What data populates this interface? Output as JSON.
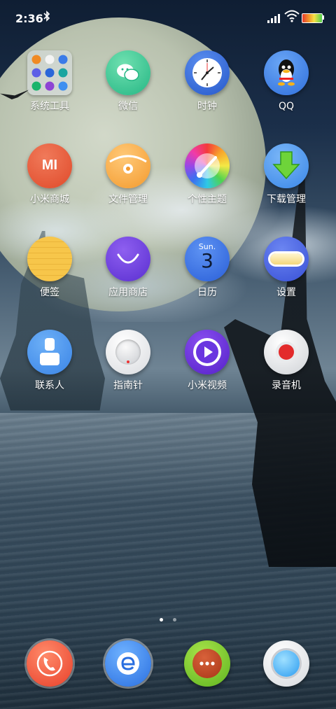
{
  "status_bar": {
    "time": "2:36",
    "battery_level": 0.6
  },
  "apps": [
    {
      "label": "系统工具",
      "icon": "folder-icon"
    },
    {
      "label": "微信",
      "icon": "wechat-icon"
    },
    {
      "label": "时钟",
      "icon": "clock-icon"
    },
    {
      "label": "QQ",
      "icon": "qq-icon"
    },
    {
      "label": "小米商城",
      "icon": "mi-store-icon"
    },
    {
      "label": "文件管理",
      "icon": "file-manager-icon"
    },
    {
      "label": "个性主题",
      "icon": "themes-icon"
    },
    {
      "label": "下载管理",
      "icon": "download-icon"
    },
    {
      "label": "便签",
      "icon": "notes-icon"
    },
    {
      "label": "应用商店",
      "icon": "app-store-icon"
    },
    {
      "label": "日历",
      "icon": "calendar-icon",
      "calendar_day": "Sun.",
      "calendar_date": "3"
    },
    {
      "label": "设置",
      "icon": "settings-icon"
    },
    {
      "label": "联系人",
      "icon": "contacts-icon"
    },
    {
      "label": "指南针",
      "icon": "compass-icon"
    },
    {
      "label": "小米视频",
      "icon": "video-icon"
    },
    {
      "label": "录音机",
      "icon": "recorder-icon"
    }
  ],
  "dock": [
    {
      "icon": "phone-icon"
    },
    {
      "icon": "browser-icon"
    },
    {
      "icon": "messages-icon"
    },
    {
      "icon": "camera-icon"
    }
  ],
  "pager": {
    "pages": 2,
    "active": 0
  },
  "mi_logo": "MI"
}
